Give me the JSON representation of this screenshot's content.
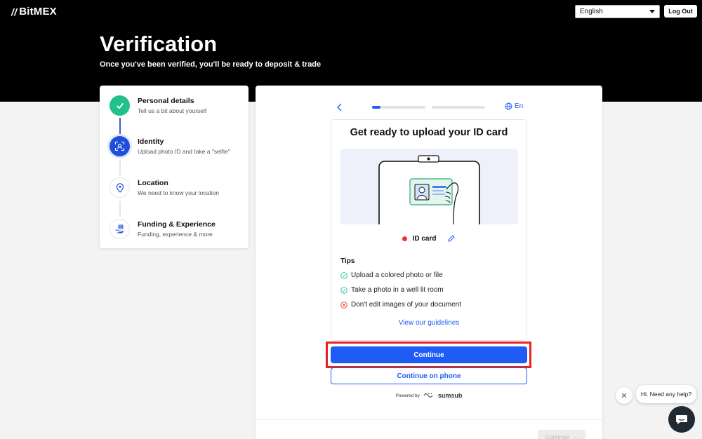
{
  "header": {
    "brand": "BitMEX",
    "brand_mark": "//",
    "language_selected": "English",
    "logout_label": "Log Out"
  },
  "hero": {
    "title": "Verification",
    "subtitle": "Once you've been verified, you'll be ready to deposit & trade"
  },
  "steps": [
    {
      "title": "Personal details",
      "desc": "Tell us a bit about yourself",
      "state": "done"
    },
    {
      "title": "Identity",
      "desc": "Upload photo ID and take a \"selfie\"",
      "state": "active"
    },
    {
      "title": "Location",
      "desc": "We need to know your location",
      "state": "pending"
    },
    {
      "title": "Funding & Experience",
      "desc": "Funding, experience & more",
      "state": "pending"
    }
  ],
  "sumsub": {
    "lang": "En",
    "title": "Get ready to upload your ID card",
    "document_type": "ID card",
    "tips_title": "Tips",
    "tips": [
      {
        "text": "Upload a colored photo or file",
        "kind": "ok"
      },
      {
        "text": "Take a photo in a well lit room",
        "kind": "ok"
      },
      {
        "text": "Don't edit images of your document",
        "kind": "bad"
      }
    ],
    "guidelines_link": "View our guidelines",
    "continue_label": "Continue",
    "phone_label": "Continue on phone",
    "powered_by": "Powered by",
    "powered_brand": "sumsub"
  },
  "footer": {
    "continue_label": "Continue"
  },
  "chat": {
    "prompt": "Hi. Need any help?",
    "close": "✕"
  },
  "colors": {
    "accent": "#1f5cf5",
    "done": "#22c08a",
    "error": "#e8362c",
    "highlight": "#e8231c"
  }
}
